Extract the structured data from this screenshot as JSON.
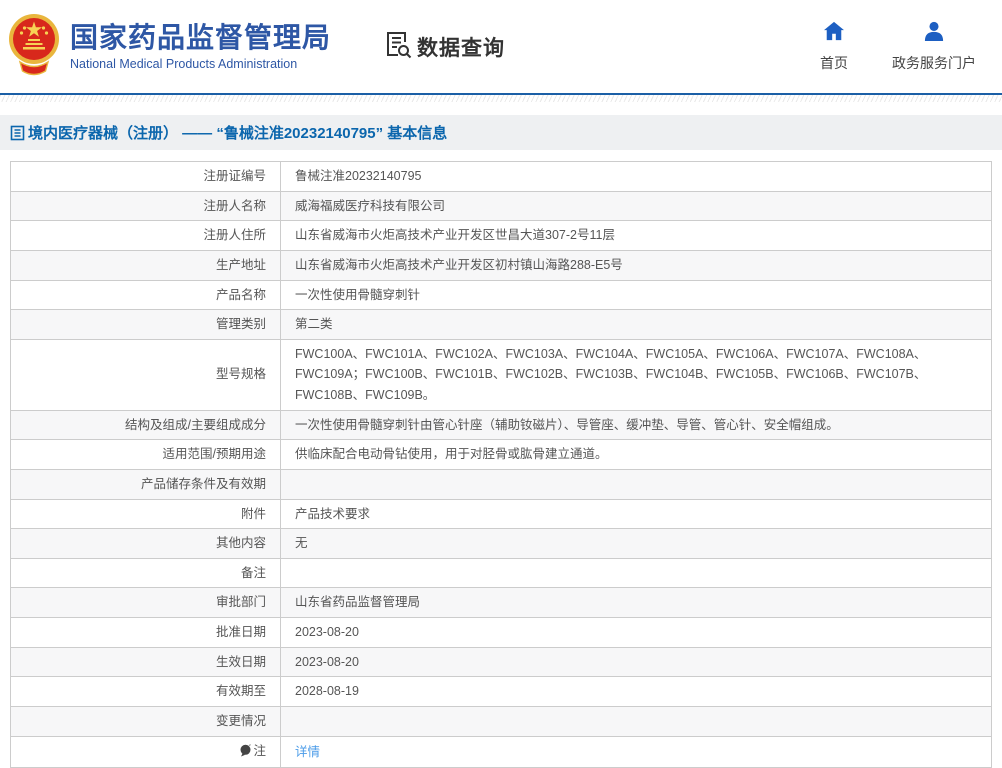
{
  "header": {
    "org_cn": "国家药品监督管理局",
    "org_en": "National Medical Products Administration",
    "section_label": "数据查询",
    "nav": [
      {
        "label": "首页"
      },
      {
        "label": "政务服务门户"
      }
    ]
  },
  "breadcrumb": {
    "text": "境内医疗器械（注册） —— “鲁械注准20232140795” 基本信息"
  },
  "detail_table": {
    "rows": [
      {
        "label": "注册证编号",
        "value": "鲁械注准20232140795"
      },
      {
        "label": "注册人名称",
        "value": "威海福威医疗科技有限公司"
      },
      {
        "label": "注册人住所",
        "value": "山东省威海市火炬高技术产业开发区世昌大道307-2号11层"
      },
      {
        "label": "生产地址",
        "value": "山东省威海市火炬高技术产业开发区初村镇山海路288-E5号"
      },
      {
        "label": "产品名称",
        "value": "一次性使用骨髓穿刺针"
      },
      {
        "label": "管理类别",
        "value": "第二类"
      },
      {
        "label": "型号规格",
        "value": "FWC100A、FWC101A、FWC102A、FWC103A、FWC104A、FWC105A、FWC106A、FWC107A、FWC108A、FWC109A；FWC100B、FWC101B、FWC102B、FWC103B、FWC104B、FWC105B、FWC106B、FWC107B、FWC108B、FWC109B。"
      },
      {
        "label": "结构及组成/主要组成成分",
        "value": "一次性使用骨髓穿刺针由管心针座（辅助钕磁片）、导管座、缓冲垫、导管、管心针、安全帽组成。"
      },
      {
        "label": "适用范围/预期用途",
        "value": "供临床配合电动骨钻使用，用于对胫骨或肱骨建立通道。"
      },
      {
        "label": "产品储存条件及有效期",
        "value": ""
      },
      {
        "label": "附件",
        "value": "产品技术要求"
      },
      {
        "label": "其他内容",
        "value": "无"
      },
      {
        "label": "备注",
        "value": ""
      },
      {
        "label": "审批部门",
        "value": "山东省药品监督管理局"
      },
      {
        "label": "批准日期",
        "value": "2023-08-20"
      },
      {
        "label": "生效日期",
        "value": "2023-08-20"
      },
      {
        "label": "有效期至",
        "value": "2028-08-19"
      },
      {
        "label": "变更情况",
        "value": ""
      },
      {
        "label": "注",
        "value": "详情"
      }
    ]
  },
  "colors": {
    "brand_blue": "#2e57a5",
    "header_line_blue": "#1b5fa6",
    "breadcrumb_blue": "#0b66ad",
    "nav_icon_blue": "#1d5fc2",
    "link_blue": "#4a9be8",
    "emblem_red": "#d8281c",
    "emblem_gold": "#e9b63d",
    "zebra_gray": "#f7f7f8"
  }
}
